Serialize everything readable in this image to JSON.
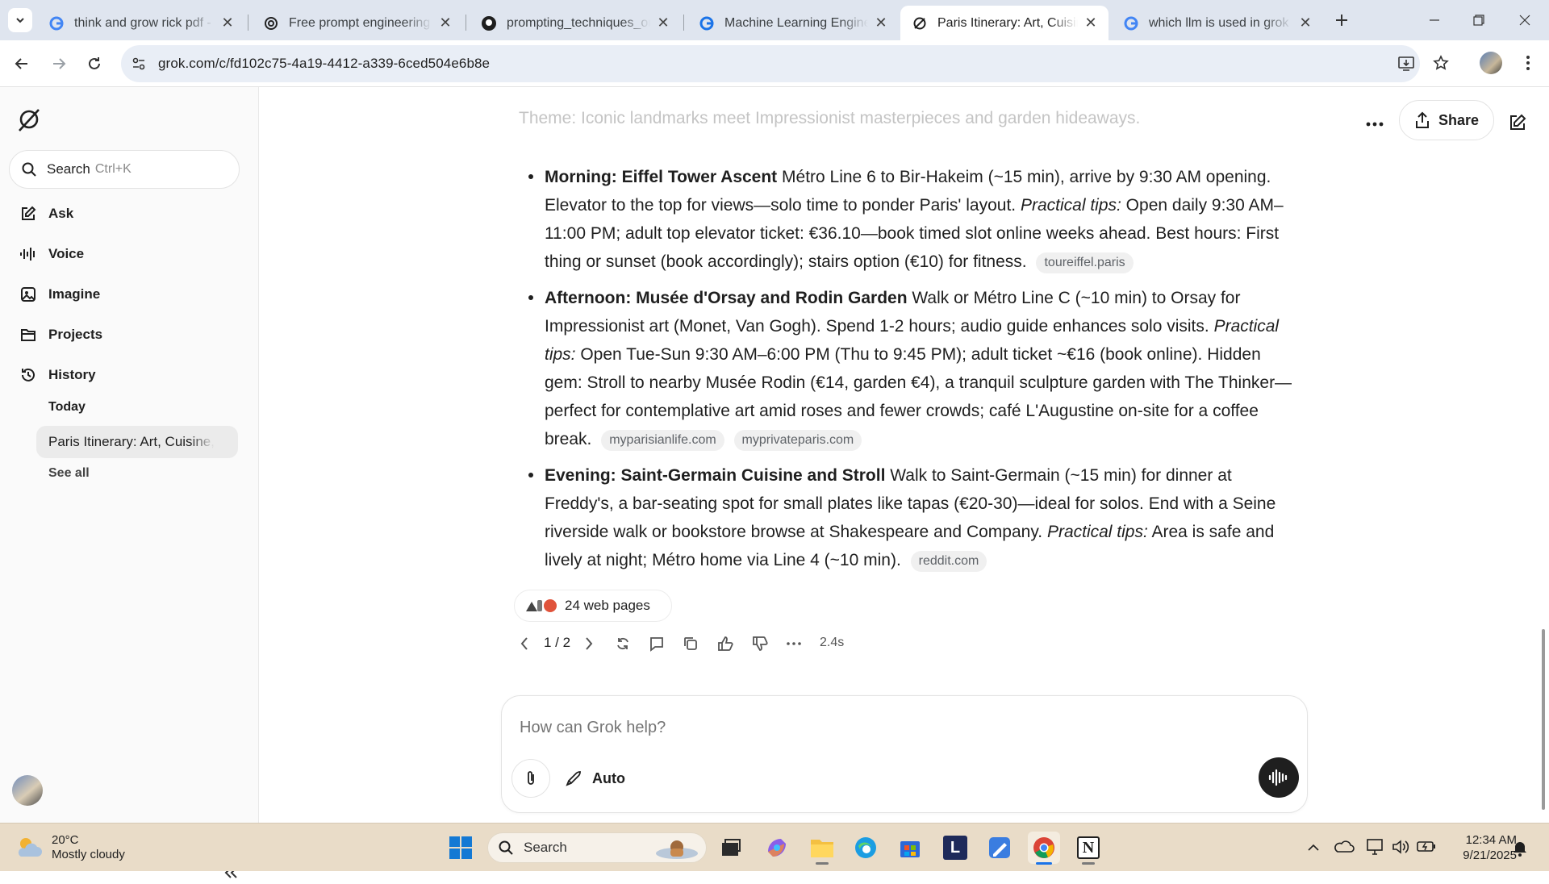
{
  "browser": {
    "tabs": [
      {
        "title": "think and grow rick pdf - Go",
        "icon": "google-icon"
      },
      {
        "title": "Free prompt engineering co",
        "icon": "openai-icon"
      },
      {
        "title": "prompting_techniques_on_",
        "icon": "github-icon"
      },
      {
        "title": "Machine Learning Engineer",
        "icon": "google-icon"
      },
      {
        "title": "Paris Itinerary: Art, Cuisine,",
        "icon": "grok-icon",
        "active": true
      },
      {
        "title": "which llm is used in grok -",
        "icon": "google-icon"
      }
    ],
    "url": "grok.com/c/fd102c75-4a19-4412-a339-6ced504e6b8e"
  },
  "sidebar": {
    "search_label": "Search",
    "search_shortcut": "Ctrl+K",
    "nav": [
      {
        "label": "Ask",
        "icon": "pencil-square-icon"
      },
      {
        "label": "Voice",
        "icon": "voice-wave-icon"
      },
      {
        "label": "Imagine",
        "icon": "image-icon"
      },
      {
        "label": "Projects",
        "icon": "folder-icon"
      },
      {
        "label": "History",
        "icon": "history-icon"
      }
    ],
    "history_section": "Today",
    "history_item": "Paris Itinerary: Art, Cuisine,",
    "see_all": "See all"
  },
  "header": {
    "share_label": "Share"
  },
  "response": {
    "faded_line": "Theme: Iconic landmarks meet Impressionist masterpieces and garden hideaways.",
    "items": [
      {
        "heading": "Morning: Eiffel Tower Ascent",
        "text1": " Métro Line 6 to Bir-Hakeim (~15 min), arrive by 9:30 AM opening. Elevator to the top for views—solo time to ponder Paris' layout. ",
        "tips_label": "Practical tips:",
        "text2": " Open daily 9:30 AM–11:00 PM; adult top elevator ticket: €36.10—book timed slot online weeks ahead. Best hours: First thing or sunset (book accordingly); stairs option (€10) for fitness.",
        "sources": [
          "toureiffel.paris"
        ]
      },
      {
        "heading": "Afternoon: Musée d'Orsay and Rodin Garden",
        "text1": " Walk or Métro Line C (~10 min) to Orsay for Impressionist art (Monet, Van Gogh). Spend 1-2 hours; audio guide enhances solo visits. ",
        "tips_label": "Practical tips:",
        "text2": " Open Tue-Sun 9:30 AM–6:00 PM (Thu to 9:45 PM); adult ticket ~€16 (book online). Hidden gem: Stroll to nearby Musée Rodin (€14, garden €4), a tranquil sculpture garden with The Thinker—perfect for contemplative art amid roses and fewer crowds; café L'Augustine on-site for a coffee break.",
        "sources": [
          "myparisianlife.com",
          "myprivateparis.com"
        ]
      },
      {
        "heading": "Evening: Saint-Germain Cuisine and Stroll",
        "text1": " Walk to Saint-Germain (~15 min) for dinner at Freddy's, a bar-seating spot for small plates like tapas (€20-30)—ideal for solos. End with a Seine riverside walk or bookstore browse at Shakespeare and Company. ",
        "tips_label": "Practical tips:",
        "text2": " Area is safe and lively at night; Métro home via Line 4 (~10 min).",
        "sources": [
          "reddit.com"
        ]
      }
    ],
    "web_pages": "24 web pages",
    "pagination": "1 / 2",
    "response_time": "2.4s"
  },
  "composer": {
    "placeholder": "How can Grok help?",
    "mode_label": "Auto"
  },
  "taskbar": {
    "temperature": "20°C",
    "weather": "Mostly cloudy",
    "search_label": "Search",
    "time": "12:34 AM",
    "date": "9/21/2025"
  }
}
